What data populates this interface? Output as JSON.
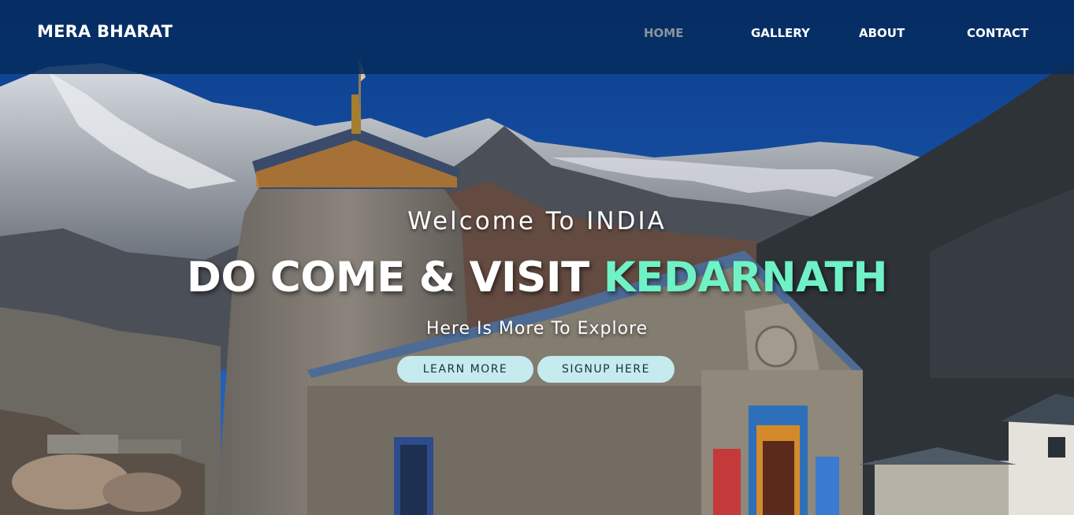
{
  "brand": "MERA BHARAT",
  "nav": {
    "home": "HOME",
    "gallery": "GALLERY",
    "about": "ABOUT",
    "contact": "CONTACT"
  },
  "hero": {
    "welcome": "Welcome To INDIA",
    "headline_prefix": "DO COME & VISIT",
    "headline_accent": "KEDARNATH",
    "tagline": "Here Is More To Explore",
    "learn_more": "LEARN MORE",
    "signup": "SIGNUP HERE"
  },
  "colors": {
    "navbar": "#062c60",
    "accent": "#6ef2c6",
    "button_bg": "#c6ebee",
    "active_nav": "#8a939c"
  }
}
